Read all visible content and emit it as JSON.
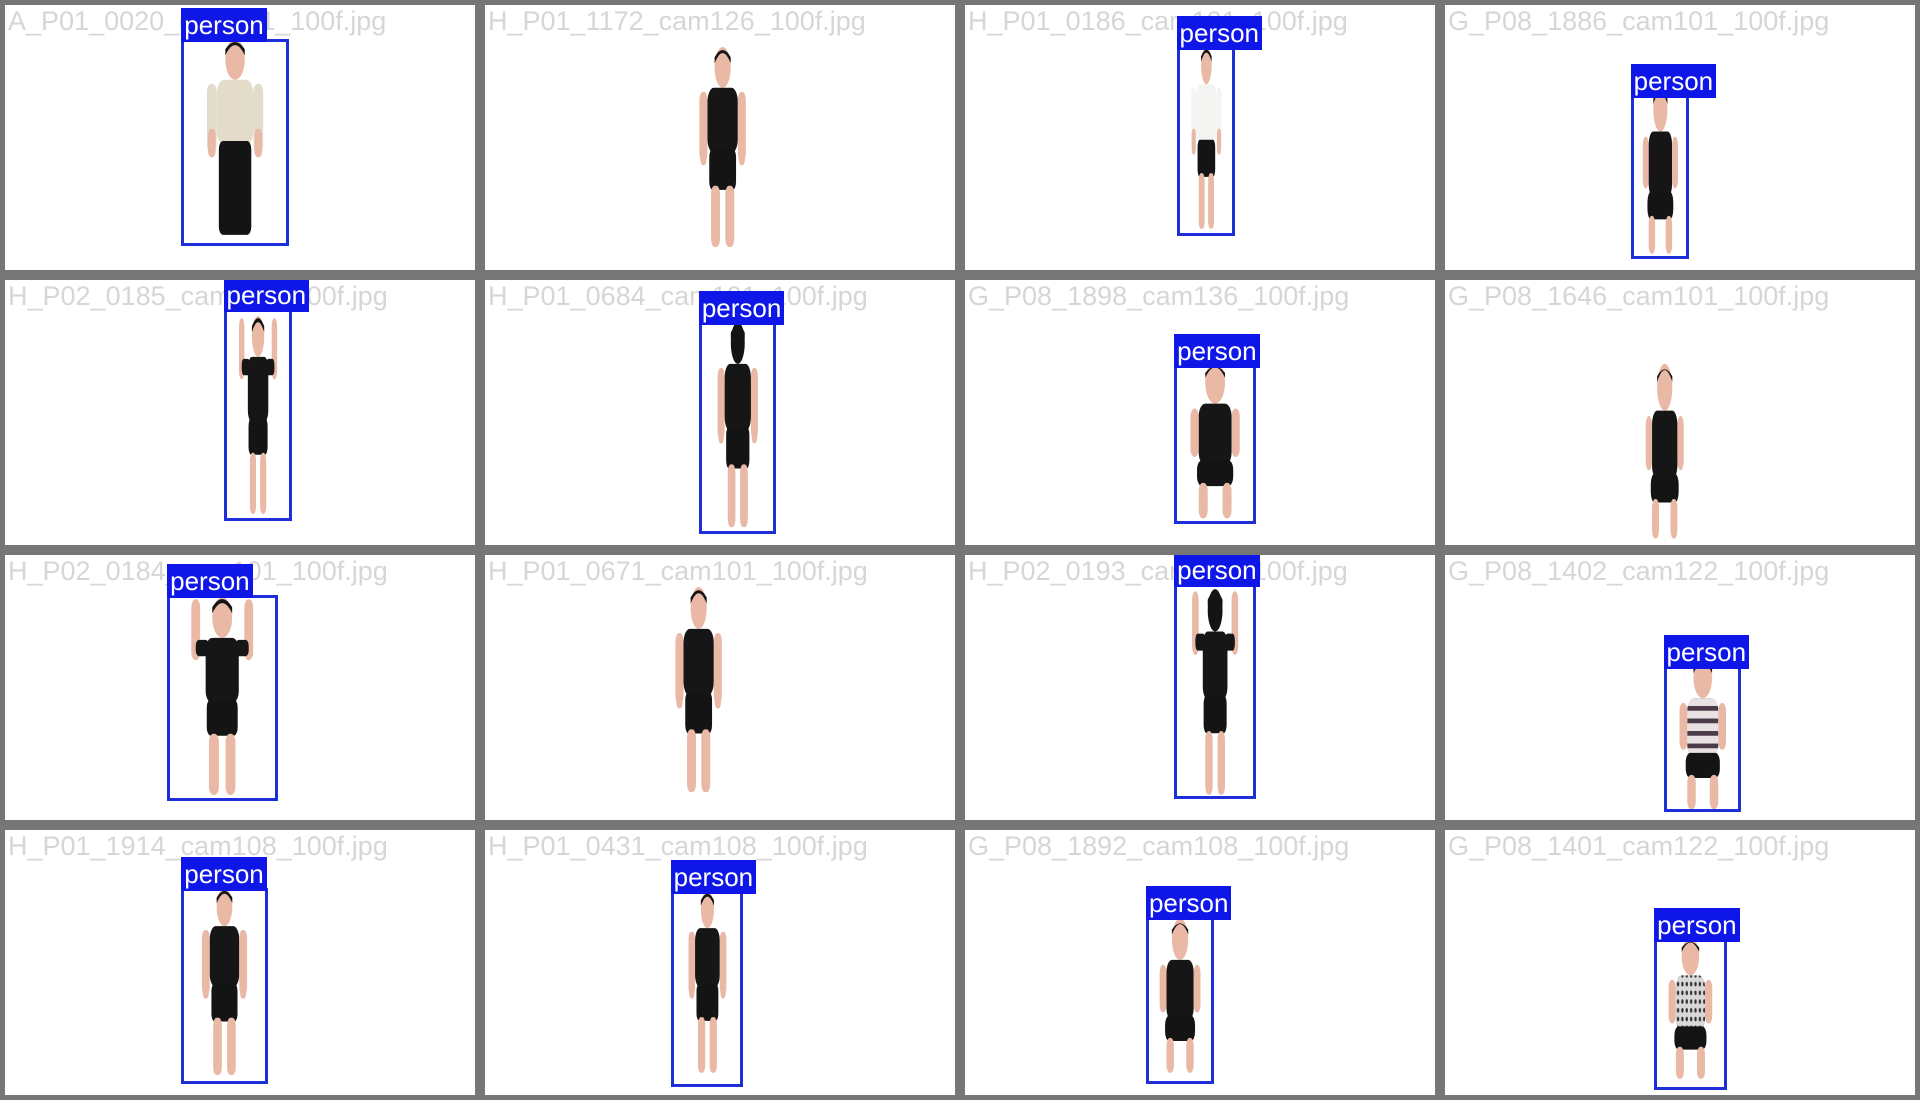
{
  "colors": {
    "grid_border": "#767676",
    "tile_background": "#ffffff",
    "box_color": "#1c2fd9",
    "label_background": "#0f17e8",
    "label_text": "#ffffff",
    "filename_text": "#d6d6d6"
  },
  "tiles": [
    {
      "filename": "A_P01_0020_cam101_100f.jpg",
      "label": "person",
      "pose": "standing-front",
      "top": "light",
      "has_box": true
    },
    {
      "filename": "H_P01_1172_cam126_100f.jpg",
      "label": "person",
      "pose": "standing-side",
      "top": "dark",
      "has_box": false
    },
    {
      "filename": "H_P01_0186_cam101_100f.jpg",
      "label": "person",
      "pose": "standing-side",
      "top": "white",
      "has_box": true
    },
    {
      "filename": "G_P08_1886_cam101_100f.jpg",
      "label": "person",
      "pose": "sitting-front",
      "top": "dark",
      "has_box": true
    },
    {
      "filename": "H_P02_0185_cam101_100f.jpg",
      "label": "person",
      "pose": "arms-up-side",
      "top": "dark",
      "has_box": true
    },
    {
      "filename": "H_P01_0684_cam101_100f.jpg",
      "label": "person",
      "pose": "standing-back",
      "top": "dark",
      "has_box": true
    },
    {
      "filename": "G_P08_1898_cam136_100f.jpg",
      "label": "person",
      "pose": "sitting-side",
      "top": "dark",
      "has_box": true
    },
    {
      "filename": "G_P08_1646_cam101_100f.jpg",
      "label": "person",
      "pose": "sitting-front",
      "top": "dark",
      "has_box": false
    },
    {
      "filename": "H_P02_0184_cam101_100f.jpg",
      "label": "person",
      "pose": "arms-up-front",
      "top": "dark",
      "has_box": true
    },
    {
      "filename": "H_P01_0671_cam101_100f.jpg",
      "label": "person",
      "pose": "standing-front",
      "top": "dark",
      "has_box": false
    },
    {
      "filename": "H_P02_0193_cam101_100f.jpg",
      "label": "person",
      "pose": "arms-up-back",
      "top": "dark",
      "has_box": true
    },
    {
      "filename": "G_P08_1402_cam122_100f.jpg",
      "label": "person",
      "pose": "sitting-back",
      "top": "striped",
      "has_box": true
    },
    {
      "filename": "H_P01_1914_cam108_100f.jpg",
      "label": "person",
      "pose": "standing-front",
      "top": "dark",
      "has_box": true
    },
    {
      "filename": "H_P01_0431_cam108_100f.jpg",
      "label": "person",
      "pose": "standing-front",
      "top": "dark",
      "has_box": true
    },
    {
      "filename": "G_P08_1892_cam108_100f.jpg",
      "label": "person",
      "pose": "sitting-front",
      "top": "dark",
      "has_box": true
    },
    {
      "filename": "G_P08_1401_cam122_100f.jpg",
      "label": "person",
      "pose": "sitting-back",
      "top": "patterned",
      "has_box": true
    }
  ]
}
